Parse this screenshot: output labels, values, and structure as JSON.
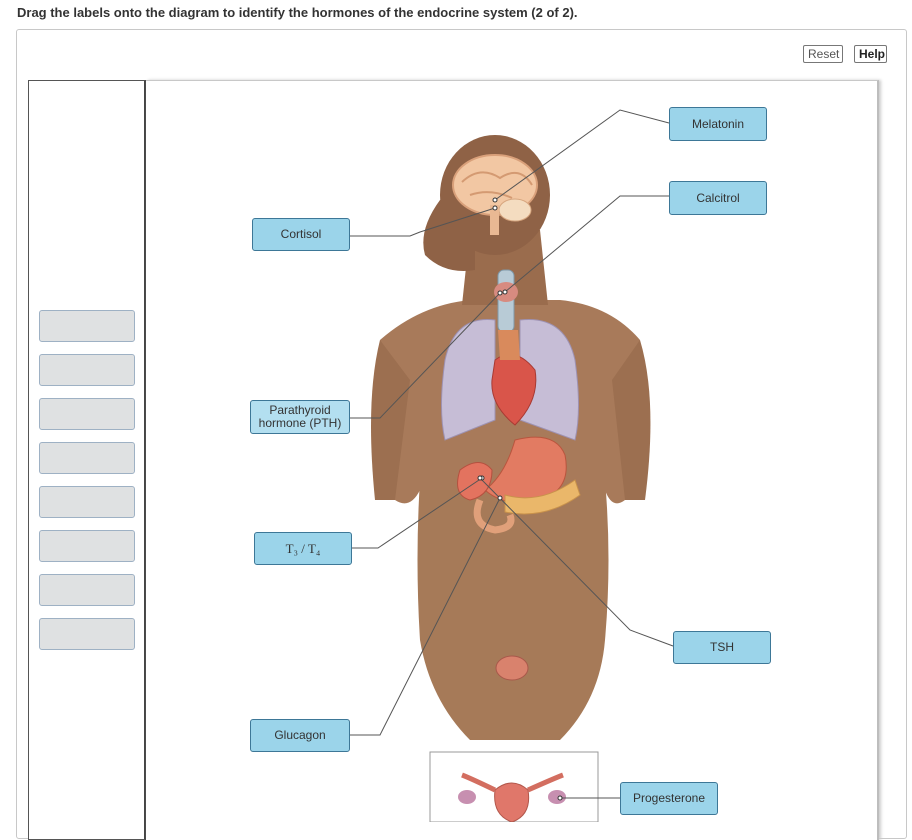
{
  "instruction": "Drag the labels onto the diagram to identify the hormones of the endocrine system (2 of 2).",
  "toolbar": {
    "reset_label": "Reset",
    "help_label": "Help"
  },
  "labels": {
    "melatonin": "Melatonin",
    "calcitrol": "Calcitrol",
    "cortisol": "Cortisol",
    "pth_line1": "Parathyroid",
    "pth_line2": "hormone (PTH)",
    "t3t4": "T₃ / T₄",
    "tsh": "TSH",
    "glucagon": "Glucagon",
    "progesterone": "Progesterone"
  },
  "tray": {
    "empty_slots": 8
  },
  "colors": {
    "label_fill": "#9bd4ea",
    "label_border": "#3d7797",
    "slot_fill": "#dfe1e2",
    "skin": "#a87a5a"
  }
}
